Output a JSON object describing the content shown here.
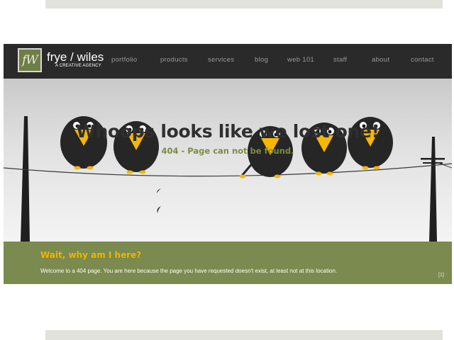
{
  "brand": {
    "logo_text": "fW",
    "name": "frye / wiles",
    "tagline": "A CREATIVE AGENCY"
  },
  "nav": {
    "items": [
      "portfolio",
      "products",
      "services",
      "blog",
      "web 101",
      "staff",
      "about",
      "contact"
    ]
  },
  "hero": {
    "headline": "Whoops looks like we lost one!",
    "subheadline": "404 - Page can not be found."
  },
  "footer": {
    "heading": "Wait, why am I here?",
    "message": "Welcome to a 404 page. You are here because the page you have requested doesn't exist, at least not at this location.",
    "reference": "[1]"
  },
  "colors": {
    "nav_bg": "#2b2a2a",
    "accent_green": "#7b8a4e",
    "accent_yellow": "#f0b400",
    "bird_body": "#262626",
    "beak": "#f5b700"
  }
}
